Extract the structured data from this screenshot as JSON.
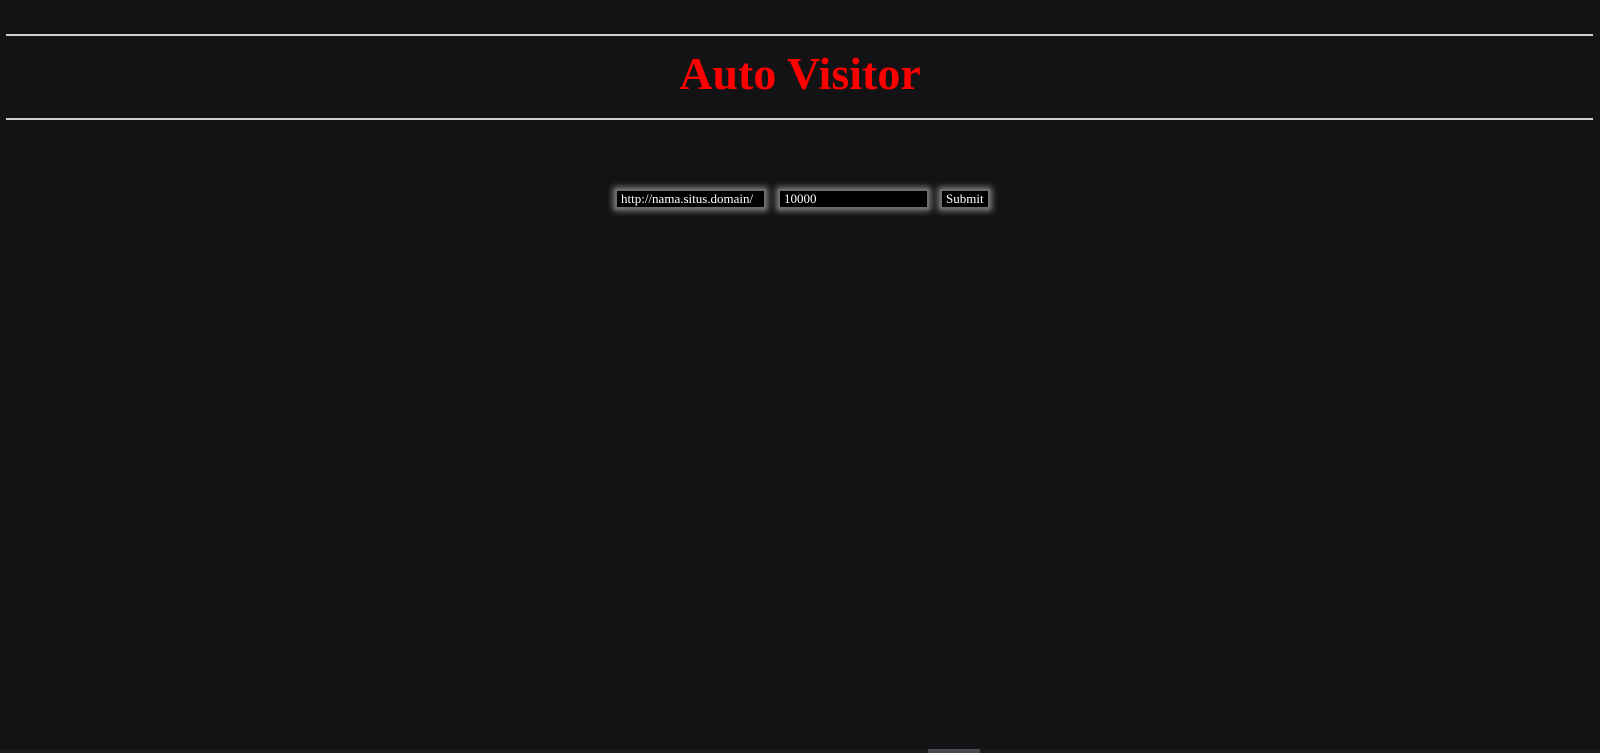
{
  "page": {
    "title": "Auto Visitor"
  },
  "form": {
    "url_value": "http://nama.situs.domain/",
    "count_value": "10000",
    "submit_label": "Submit"
  },
  "colors": {
    "background": "#131315",
    "title": "#ff0000",
    "rule": "#d0d0d0",
    "field_background": "#000000",
    "field_text": "#ffffff"
  }
}
